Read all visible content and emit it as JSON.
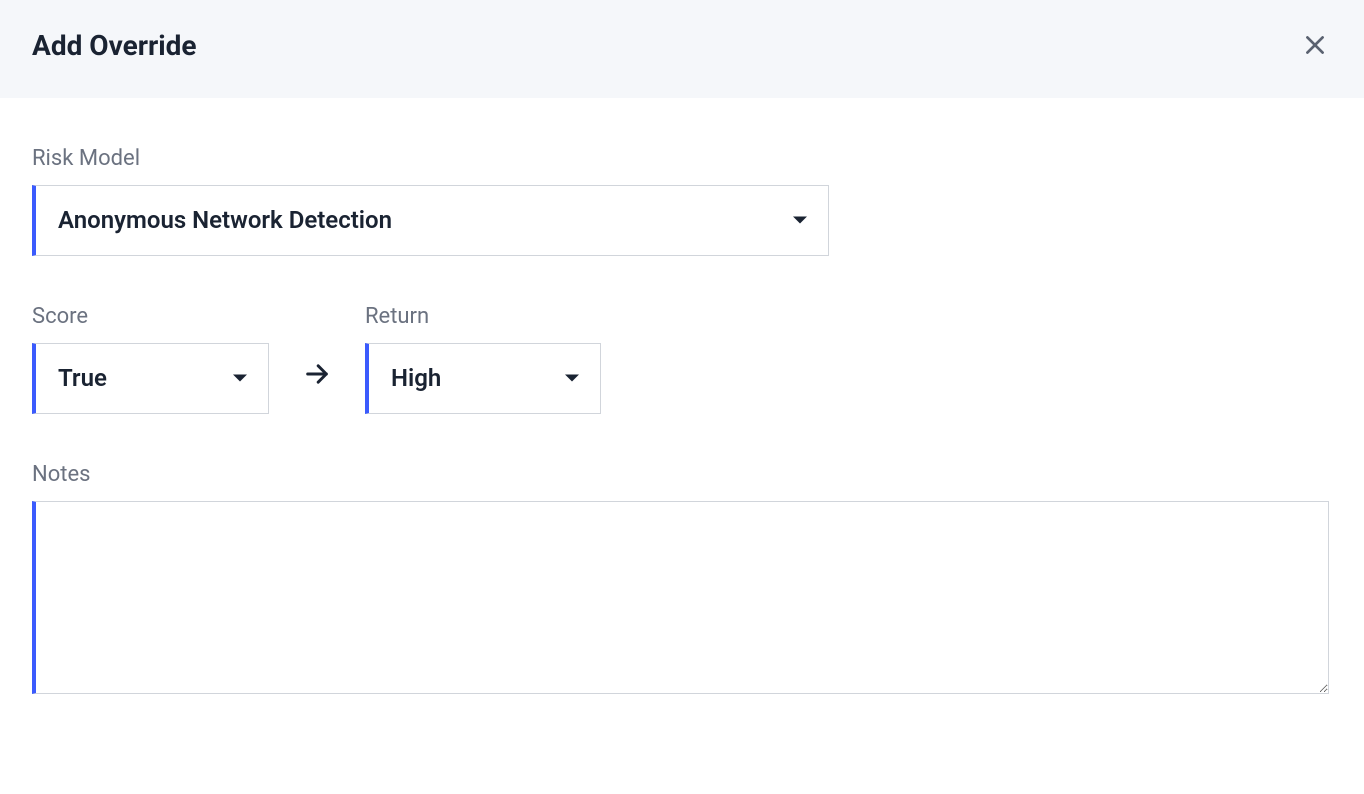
{
  "header": {
    "title": "Add Override"
  },
  "riskModel": {
    "label": "Risk Model",
    "value": "Anonymous Network Detection"
  },
  "score": {
    "label": "Score",
    "value": "True"
  },
  "return": {
    "label": "Return",
    "value": "High"
  },
  "notes": {
    "label": "Notes",
    "value": ""
  }
}
